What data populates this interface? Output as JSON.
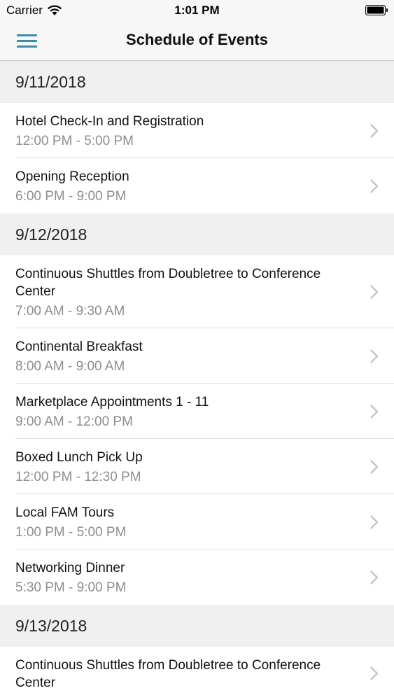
{
  "status_bar": {
    "carrier": "Carrier",
    "time": "1:01 PM"
  },
  "nav": {
    "title": "Schedule of Events"
  },
  "colors": {
    "accent": "#3a8cab",
    "section_bg": "#f0f0f0",
    "subtext": "#8e8e8e"
  },
  "sections": [
    {
      "date": "9/11/2018",
      "events": [
        {
          "title": "Hotel Check-In and Registration",
          "time": "12:00 PM - 5:00 PM"
        },
        {
          "title": "Opening Reception",
          "time": "6:00 PM - 9:00 PM"
        }
      ]
    },
    {
      "date": "9/12/2018",
      "events": [
        {
          "title": "Continuous Shuttles from Doubletree to Conference Center",
          "time": "7:00 AM - 9:30 AM"
        },
        {
          "title": "Continental Breakfast",
          "time": "8:00 AM - 9:00 AM"
        },
        {
          "title": "Marketplace Appointments 1 - 11",
          "time": "9:00 AM - 12:00 PM"
        },
        {
          "title": "Boxed Lunch Pick Up",
          "time": "12:00 PM - 12:30 PM"
        },
        {
          "title": "Local FAM Tours",
          "time": "1:00 PM - 5:00 PM"
        },
        {
          "title": "Networking Dinner",
          "time": "5:30 PM - 9:00 PM"
        }
      ]
    },
    {
      "date": "9/13/2018",
      "events": [
        {
          "title": "Continuous Shuttles from Doubletree to Conference Center",
          "time": ""
        }
      ]
    }
  ]
}
